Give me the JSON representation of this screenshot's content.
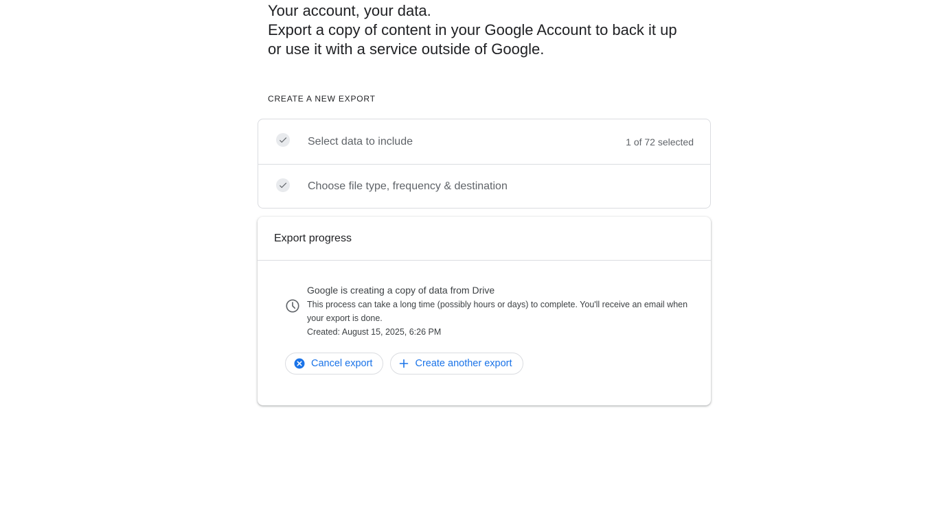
{
  "hero": {
    "line1": "Your account, your data.",
    "line2": "Export a copy of content in your Google Account to back it up",
    "line3": "or use it with a service outside of Google."
  },
  "section_label": "CREATE A NEW EXPORT",
  "steps": [
    {
      "label": "Select data to include",
      "count": "1 of 72 selected",
      "icon": "check-icon"
    },
    {
      "label": "Choose file type, frequency & destination",
      "icon": "check-icon"
    }
  ],
  "progress": {
    "header": "Export progress",
    "icon": "clock-icon",
    "title": "Google is creating a copy of data from Drive",
    "description": "This process can take a long time (possibly hours or days) to complete. You'll receive an email when your export is done.",
    "created": "Created: August 15, 2025, 6:26 PM"
  },
  "actions": {
    "cancel_label": "Cancel export",
    "create_label": "Create another export"
  },
  "colors": {
    "accent": "#1a73e8",
    "border": "#dadce0",
    "text": "#202124",
    "muted": "#5f6368"
  }
}
